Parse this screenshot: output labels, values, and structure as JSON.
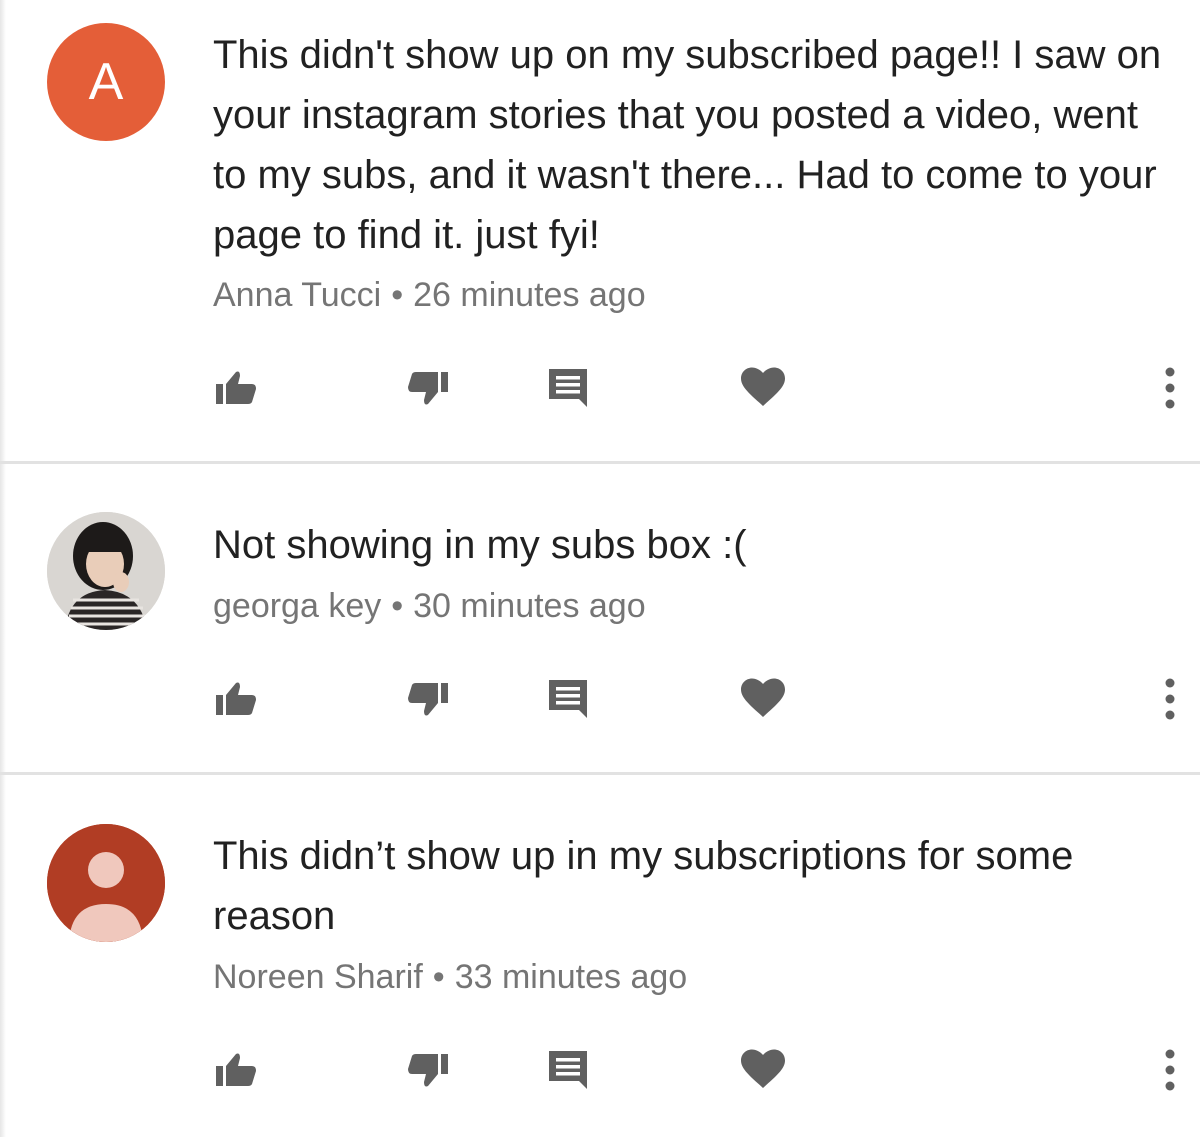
{
  "comments": [
    {
      "avatar": {
        "kind": "letter",
        "letter": "A",
        "color": "#e45e38"
      },
      "text": "This didn't show up on my subscribed page!! I saw on your instagram stories that you posted a video, went to my subs, and it wasn't there... Had to come to your page to find it. just fyi!",
      "author": "Anna Tucci",
      "separator": "•",
      "time": "26 minutes ago"
    },
    {
      "avatar": {
        "kind": "photo",
        "color": "#d9d6d2"
      },
      "text": "Not showing in my subs box :(",
      "author": "georga key",
      "separator": "•",
      "time": "30 minutes ago"
    },
    {
      "avatar": {
        "kind": "default-person",
        "color": "#b13d24"
      },
      "text": "This didn’t show up in my subscriptions for some reason",
      "author": "Noreen Sharif",
      "separator": "•",
      "time": "33 minutes ago"
    }
  ],
  "icons": {
    "like": "thumbs-up-icon",
    "dislike": "thumbs-down-icon",
    "reply": "reply-icon",
    "heart": "heart-icon",
    "more": "more-vert-icon"
  },
  "colors": {
    "icon": "#606060",
    "text": "#212121",
    "meta": "#757575",
    "divider": "#e2e2e2"
  }
}
